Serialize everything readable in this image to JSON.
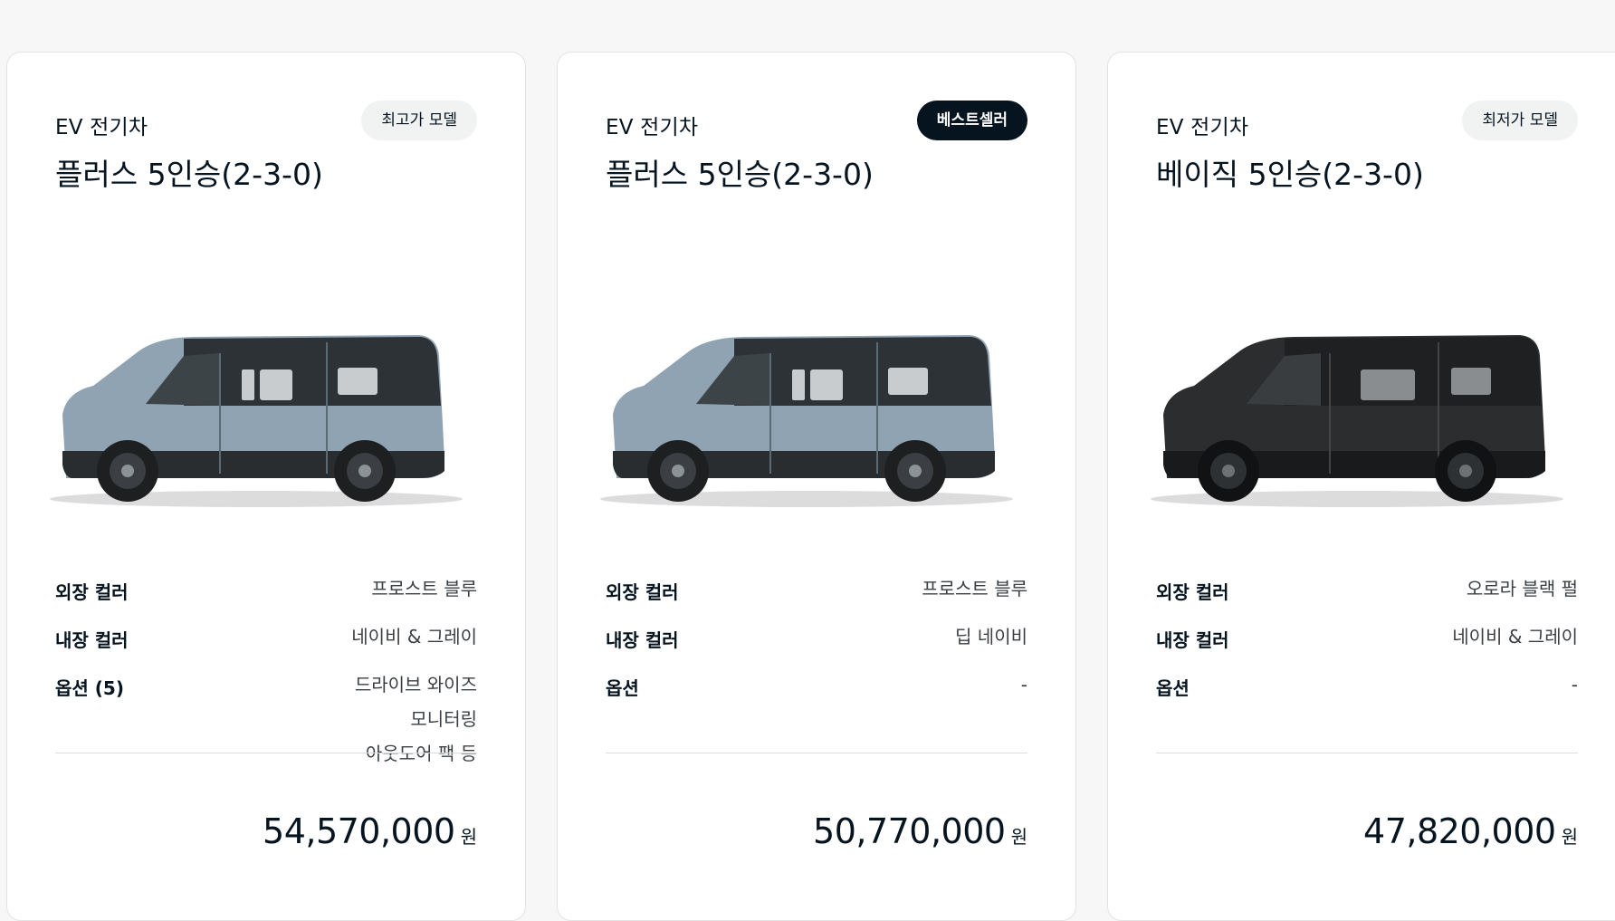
{
  "cards": [
    {
      "fuel": "EV 전기차",
      "model": "플러스 5인승(2-3-0)",
      "badge": "최고가 모델",
      "badge_style": "light",
      "car_color": "#8fa3b2",
      "car_body": "blue",
      "exterior_label": "외장 컬러",
      "exterior_value": "프로스트 블루",
      "interior_label": "내장 컬러",
      "interior_value": "네이비 & 그레이",
      "options_label": "옵션 (5)",
      "options_values": [
        "드라이브 와이즈",
        "모니터링",
        "아웃도어 팩 등"
      ],
      "price": "54,570,000",
      "unit": "원"
    },
    {
      "fuel": "EV 전기차",
      "model": "플러스 5인승(2-3-0)",
      "badge": "베스트셀러",
      "badge_style": "dark",
      "car_color": "#8fa3b2",
      "car_body": "blue",
      "exterior_label": "외장 컬러",
      "exterior_value": "프로스트 블루",
      "interior_label": "내장 컬러",
      "interior_value": "딥 네이비",
      "options_label": "옵션",
      "options_values": [
        "-"
      ],
      "price": "50,770,000",
      "unit": "원"
    },
    {
      "fuel": "EV 전기차",
      "model": "베이직 5인승(2-3-0)",
      "badge": "최저가 모델",
      "badge_style": "light",
      "car_color": "#2b2d2f",
      "car_body": "black",
      "exterior_label": "외장 컬러",
      "exterior_value": "오로라 블랙 펄",
      "interior_label": "내장 컬러",
      "interior_value": "네이비 & 그레이",
      "options_label": "옵션",
      "options_values": [
        "-"
      ],
      "price": "47,820,000",
      "unit": "원"
    }
  ]
}
